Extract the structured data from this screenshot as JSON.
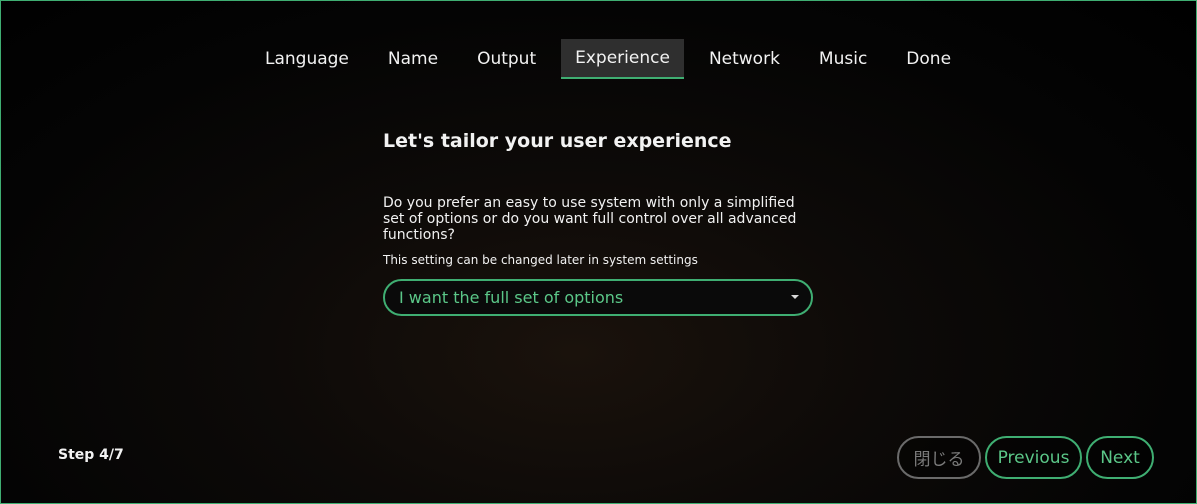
{
  "tabs": [
    {
      "label": "Language"
    },
    {
      "label": "Name"
    },
    {
      "label": "Output"
    },
    {
      "label": "Experience",
      "active": true
    },
    {
      "label": "Network"
    },
    {
      "label": "Music"
    },
    {
      "label": "Done"
    }
  ],
  "content": {
    "title": "Let's tailor your user experience",
    "question": "Do you prefer an easy to use system with only a simplified set of options or do you want full control over all advanced functions?",
    "hint": "This setting can be changed later in system settings",
    "select_value": "I want the full set of options"
  },
  "footer": {
    "step": "Step 4/7",
    "close_label": "閉じる",
    "previous_label": "Previous",
    "next_label": "Next"
  },
  "colors": {
    "accent": "#3fae72",
    "accent_text": "#5bc788",
    "active_tab_bg": "#2f2f2f"
  }
}
